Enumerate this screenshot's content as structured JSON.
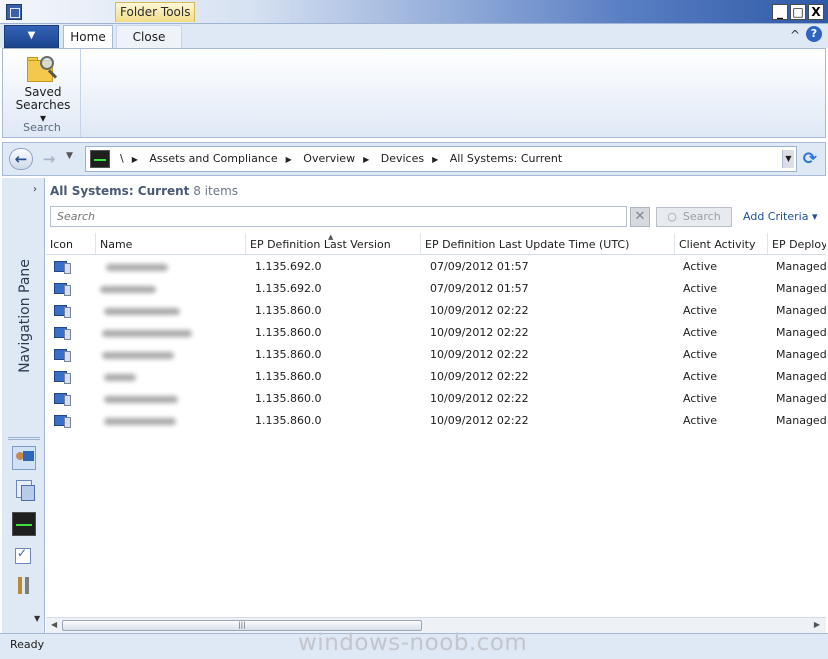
{
  "window": {
    "contextual_tab": "Folder Tools",
    "buttons": [
      "_",
      "□",
      "X"
    ]
  },
  "ribbon": {
    "tabs": [
      {
        "label": "Home",
        "selected": true
      },
      {
        "label": "Close",
        "selected": false
      }
    ],
    "saved_searches_label_line1": "Saved",
    "saved_searches_label_line2": "Searches ▾",
    "group_label": "Search",
    "help_icon": "?",
    "collapse_icon": "^"
  },
  "address_bar": {
    "breadcrumbs": [
      "\\",
      "Assets and Compliance",
      "Overview",
      "Devices",
      "All Systems: Current"
    ]
  },
  "nav_pane": {
    "title": "Navigation Pane",
    "icons": [
      "assets-and-compliance-icon",
      "software-library-icon",
      "monitoring-icon",
      "administration-icon",
      "tools-icon"
    ]
  },
  "view": {
    "title": "All Systems: Current",
    "count": "8 items",
    "search_placeholder": "Search",
    "search_button": "Search",
    "add_criteria": "Add Criteria ▾",
    "clear_icon": "✕"
  },
  "table": {
    "columns": [
      "Icon",
      "Name",
      "EP Definition Last Version",
      "EP Definition Last Update Time (UTC)",
      "Client Activity",
      "EP Deployment"
    ],
    "rows": [
      {
        "name": "",
        "version": "1.135.692.0",
        "update_time": "07/09/2012 01:57",
        "activity": "Active",
        "deployment": "Managed"
      },
      {
        "name": "",
        "version": "1.135.692.0",
        "update_time": "07/09/2012 01:57",
        "activity": "Active",
        "deployment": "Managed"
      },
      {
        "name": "",
        "version": "1.135.860.0",
        "update_time": "10/09/2012 02:22",
        "activity": "Active",
        "deployment": "Managed"
      },
      {
        "name": "",
        "version": "1.135.860.0",
        "update_time": "10/09/2012 02:22",
        "activity": "Active",
        "deployment": "Managed"
      },
      {
        "name": "",
        "version": "1.135.860.0",
        "update_time": "10/09/2012 02:22",
        "activity": "Active",
        "deployment": "Managed"
      },
      {
        "name": "",
        "version": "1.135.860.0",
        "update_time": "10/09/2012 02:22",
        "activity": "Active",
        "deployment": "Managed"
      },
      {
        "name": "",
        "version": "1.135.860.0",
        "update_time": "10/09/2012 02:22",
        "activity": "Active",
        "deployment": "Managed"
      },
      {
        "name": "",
        "version": "1.135.860.0",
        "update_time": "10/09/2012 02:22",
        "activity": "Active",
        "deployment": "Managed"
      }
    ]
  },
  "status": {
    "text": "Ready",
    "watermark": "windows-noob.com"
  }
}
